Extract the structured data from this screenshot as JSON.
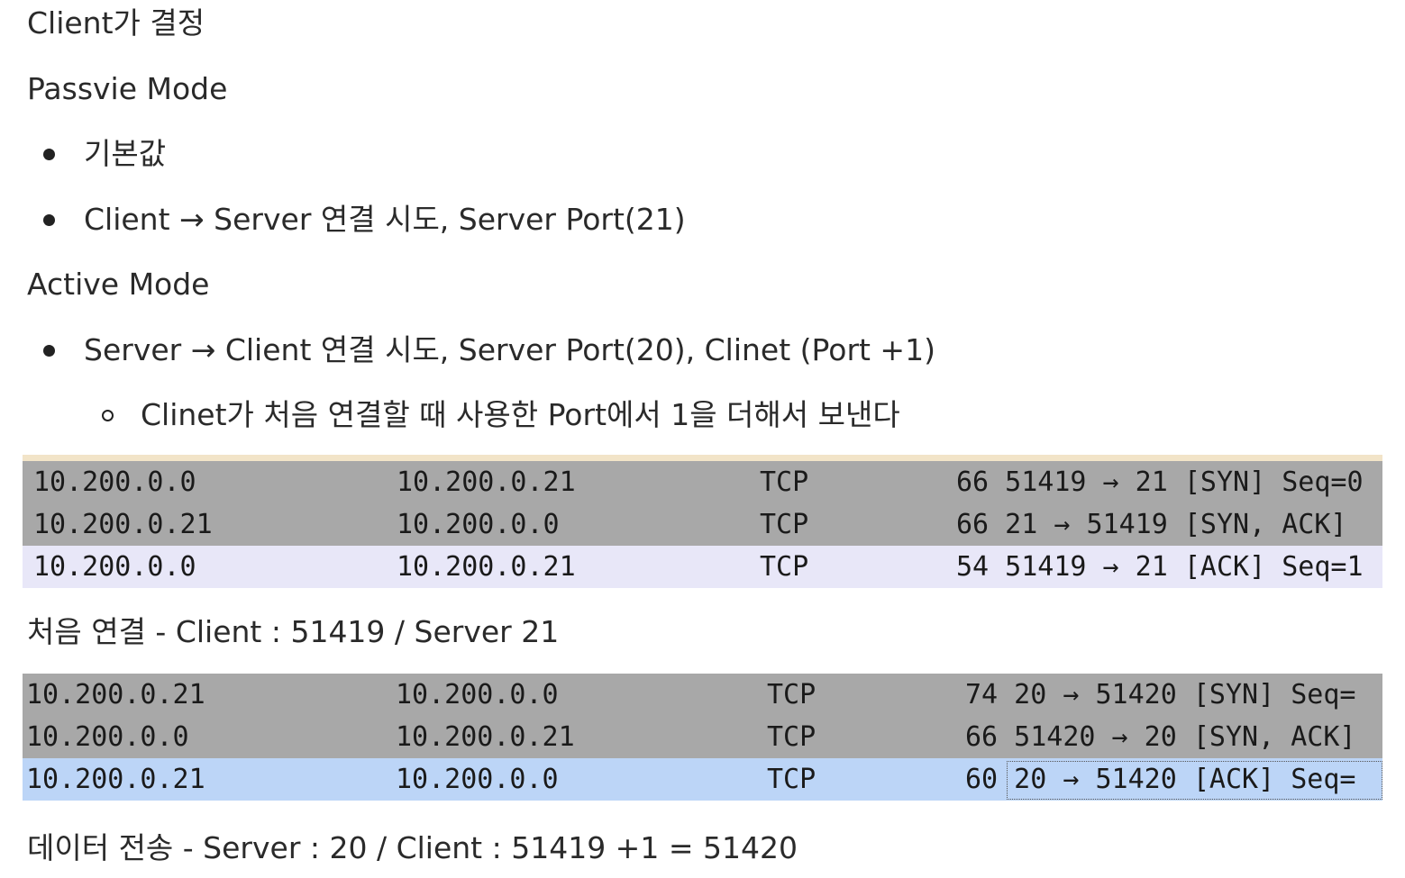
{
  "doc": {
    "heading_client_decides": "Client가 결정",
    "passive_mode": {
      "title": "Passvie Mode",
      "bullets": [
        "기본값",
        "Client → Server 연결 시도, Server Port(21)"
      ]
    },
    "active_mode": {
      "title": "Active Mode",
      "bullets": [
        "Server → Client 연결 시도, Server Port(20), Clinet (Port +1)"
      ],
      "sub_bullets": [
        "Clinet가 처음 연결할 때 사용한 Port에서 1을 더해서 보낸다"
      ]
    },
    "capture_1": {
      "rows": [
        {
          "src": "10.200.0.0",
          "dst": "10.200.0.21",
          "proto": "TCP",
          "info": "66 51419 → 21 [SYN] Seq=0"
        },
        {
          "src": "10.200.0.21",
          "dst": "10.200.0.0",
          "proto": "TCP",
          "info": "66 21 → 51419 [SYN, ACK]"
        },
        {
          "src": "10.200.0.0",
          "dst": "10.200.0.21",
          "proto": "TCP",
          "info": "54 51419 → 21 [ACK] Seq=1"
        }
      ],
      "caption": "처음 연결 - Client : 51419 / Server 21"
    },
    "capture_2": {
      "rows": [
        {
          "src": "10.200.0.21",
          "dst": "10.200.0.0",
          "proto": "TCP",
          "info": "74 20 → 51420 [SYN] Seq="
        },
        {
          "src": "10.200.0.0",
          "dst": "10.200.0.21",
          "proto": "TCP",
          "info": "66 51420 → 20 [SYN, ACK]"
        },
        {
          "src": "10.200.0.21",
          "dst": "10.200.0.0",
          "proto": "TCP",
          "info": "60 20 → 51420 [ACK] Seq="
        }
      ],
      "caption": "데이터 전송 - Server : 20 / Client : 51419 +1 = 51420"
    }
  },
  "colors": {
    "text": "#2a2a2a",
    "row_grey": "#a8a8a8",
    "row_lavender": "#e8e7f8",
    "row_blue": "#bcd5f7"
  }
}
